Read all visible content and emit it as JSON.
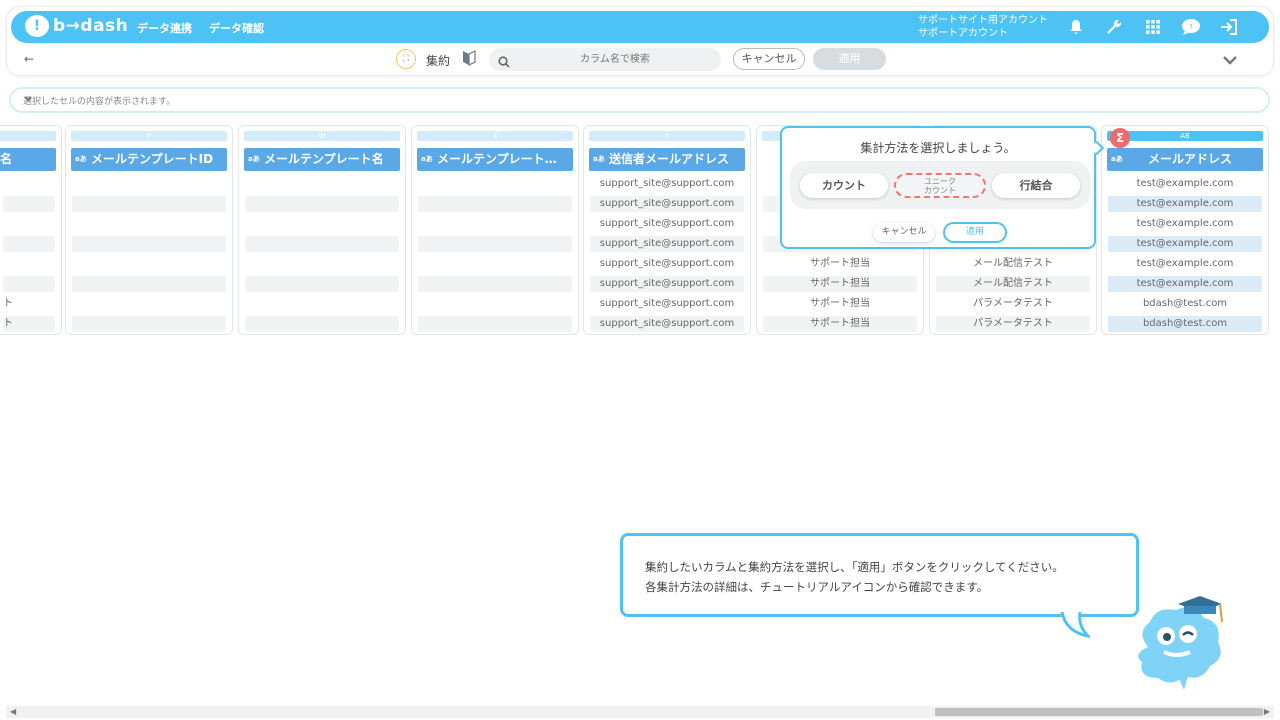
{
  "app": {
    "logo_text": "b→dash",
    "nav": [
      "データ連携",
      "データ確認"
    ],
    "account_line1": "サポートサイト用アカウント",
    "account_line2": "サポートアカウント"
  },
  "toolbar": {
    "back": "←",
    "agg_label": "集約",
    "search_placeholder": "カラム名で検索",
    "cancel_label": "キャンセル",
    "apply_label": "適用"
  },
  "cell_bar": {
    "placeholder": "選択したセルの内容が表示されます。"
  },
  "columns": [
    {
      "letter": "",
      "title": "ツ名",
      "cells": [
        "",
        "",
        "",
        "",
        "",
        "",
        "ト",
        "ト"
      ]
    },
    {
      "letter": "V",
      "title": "メールテンプレートID",
      "cells": [
        "",
        "",
        "",
        "",
        "",
        "",
        "",
        ""
      ]
    },
    {
      "letter": "W",
      "title": "メールテンプレート名",
      "cells": [
        "",
        "",
        "",
        "",
        "",
        "",
        "",
        ""
      ]
    },
    {
      "letter": "X",
      "title": "メールテンプレート…",
      "cells": [
        "",
        "",
        "",
        "",
        "",
        "",
        "",
        ""
      ]
    },
    {
      "letter": "Y",
      "title": "送信者メールアドレス",
      "cells": [
        "support_site@support.com",
        "support_site@support.com",
        "support_site@support.com",
        "support_site@support.com",
        "support_site@support.com",
        "support_site@support.com",
        "support_site@support.com",
        "support_site@support.com"
      ]
    },
    {
      "letter": "",
      "title": "",
      "cells": [
        "",
        "",
        "",
        "",
        "サポート担当",
        "サポート担当",
        "サポート担当",
        "サポート担当"
      ]
    },
    {
      "letter": "",
      "title": "",
      "cells": [
        "",
        "",
        "",
        "",
        "メール配信テスト",
        "メール配信テスト",
        "パラメータテスト",
        "パラメータテスト"
      ]
    },
    {
      "letter": "AB",
      "title": "メールアドレス",
      "cells": [
        "test@example.com",
        "test@example.com",
        "test@example.com",
        "test@example.com",
        "test@example.com",
        "test@example.com",
        "bdash@test.com",
        "bdash@test.com"
      ]
    }
  ],
  "popup": {
    "title": "集計方法を選択しましょう。",
    "options": [
      "カウント",
      "ユニーク\nカウント",
      "行結合"
    ],
    "cancel_label": "キャンセル",
    "apply_label": "適用"
  },
  "guide": {
    "line1": "集約したいカラムと集約方法を選択し、「適用」ボタンをクリックしてください。",
    "line2": "各集計方法の詳細は、チュートリアルアイコンから確認できます。"
  },
  "colors": {
    "primary": "#4cc3f4",
    "header_blue": "#5aa8e6",
    "highlight_red": "#ef6a6a"
  }
}
